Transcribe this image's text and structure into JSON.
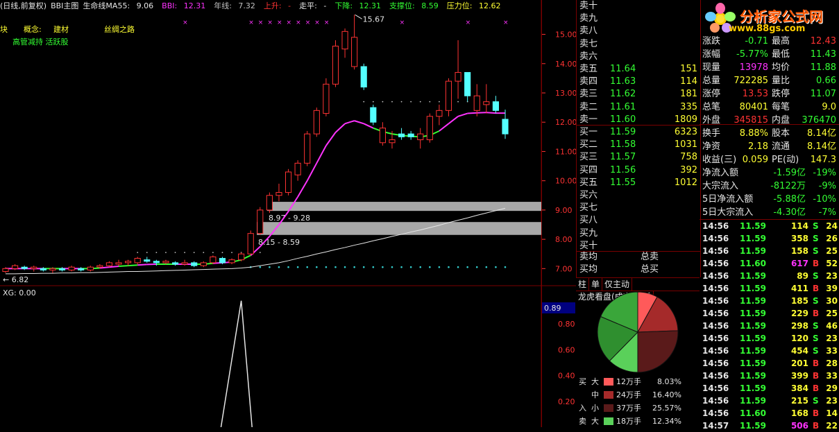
{
  "top_bar": {
    "mode": "(日线,前复权)",
    "indicator": "BBI主图",
    "ma55_label": "生命线MA55:",
    "ma55_value": "9.06",
    "bbi_label": "BBI:",
    "bbi_value": "12.31",
    "year_label": "年线:",
    "year_value": "7.32",
    "up_label": "上升:",
    "up_value": "-",
    "flat_label": "走平:",
    "flat_value": "-",
    "down_label": "下降:",
    "down_value": "12.31",
    "support_label": "支撑位:",
    "support_value": "8.59",
    "pressure_label": "压力位:",
    "pressure_value": "12.62"
  },
  "tags": {
    "t1": "块",
    "t2": "概念:",
    "t3": "建材",
    "t4": "丝绸之路",
    "t5": "高管减持 活跃股"
  },
  "annotations": {
    "high": "15.67",
    "low": "6.82",
    "zone1": "8.97 - 9.28",
    "zone2": "8.15 - 8.59",
    "xg": "XG: 0.00",
    "lower_value": "0.89"
  },
  "y_axis_main": [
    "15.00",
    "14.00",
    "13.00",
    "12.00",
    "11.00",
    "10.00",
    "9.00",
    "8.00",
    "7.00"
  ],
  "y_axis_lower": [
    "0.80",
    "0.60",
    "0.40",
    "0.20"
  ],
  "logo": {
    "title": "分析家公式网",
    "url": "www.88gs.com"
  },
  "order_book": {
    "sell": [
      {
        "label": "卖十",
        "price": "",
        "vol": ""
      },
      {
        "label": "卖九",
        "price": "",
        "vol": ""
      },
      {
        "label": "卖八",
        "price": "",
        "vol": ""
      },
      {
        "label": "卖七",
        "price": "",
        "vol": ""
      },
      {
        "label": "卖六",
        "price": "",
        "vol": ""
      },
      {
        "label": "卖五",
        "price": "11.64",
        "vol": "151"
      },
      {
        "label": "卖四",
        "price": "11.63",
        "vol": "114"
      },
      {
        "label": "卖三",
        "price": "11.62",
        "vol": "181"
      },
      {
        "label": "卖二",
        "price": "11.61",
        "vol": "335"
      },
      {
        "label": "卖一",
        "price": "11.60",
        "vol": "1809"
      }
    ],
    "buy": [
      {
        "label": "买一",
        "price": "11.59",
        "vol": "6323"
      },
      {
        "label": "买二",
        "price": "11.58",
        "vol": "1031"
      },
      {
        "label": "买三",
        "price": "11.57",
        "vol": "758"
      },
      {
        "label": "买四",
        "price": "11.56",
        "vol": "392"
      },
      {
        "label": "买五",
        "price": "11.55",
        "vol": "1012"
      },
      {
        "label": "买六",
        "price": "",
        "vol": ""
      },
      {
        "label": "买七",
        "price": "",
        "vol": ""
      },
      {
        "label": "买八",
        "price": "",
        "vol": ""
      },
      {
        "label": "买九",
        "price": "",
        "vol": ""
      },
      {
        "label": "买十",
        "price": "",
        "vol": ""
      }
    ],
    "avg_buy_label": "卖均",
    "avg_sell_label": "买均",
    "total_sell_label": "总卖",
    "total_buy_label": "总买"
  },
  "info": [
    {
      "k1": "涨跌",
      "v1": "-0.71",
      "c1": "#33ff33",
      "k2": "最高",
      "v2": "12.43",
      "c2": "#ff3333"
    },
    {
      "k1": "涨幅",
      "v1": "-5.77%",
      "c1": "#33ff33",
      "k2": "最低",
      "v2": "11.43",
      "c2": "#33ff33"
    },
    {
      "k1": "现量",
      "v1": "13978",
      "c1": "#ff33ff",
      "k2": "均价",
      "v2": "11.88",
      "c2": "#33ff33"
    },
    {
      "k1": "总量",
      "v1": "722285",
      "c1": "#ffff33",
      "k2": "量比",
      "v2": "0.66",
      "c2": "#33ff33"
    },
    {
      "k1": "涨停",
      "v1": "13.53",
      "c1": "#ff3333",
      "k2": "跌停",
      "v2": "11.07",
      "c2": "#33ff33"
    },
    {
      "k1": "总笔",
      "v1": "80401",
      "c1": "#ffff33",
      "k2": "每笔",
      "v2": "9.0",
      "c2": "#ffff33"
    },
    {
      "k1": "外盘",
      "v1": "345815",
      "c1": "#ff3333",
      "k2": "内盘",
      "v2": "376470",
      "c2": "#33ff33"
    },
    {
      "k1": "换手",
      "v1": "8.88%",
      "c1": "#ffff33",
      "k2": "股本",
      "v2": "8.14亿",
      "c2": "#ffff33"
    },
    {
      "k1": "净资",
      "v1": "2.18",
      "c1": "#ffff33",
      "k2": "流通",
      "v2": "8.14亿",
      "c2": "#ffff33"
    },
    {
      "k1": "收益(三)",
      "v1": "0.059",
      "c1": "#ffff33",
      "k2": "PE(动)",
      "v2": "147.3",
      "c2": "#ffff33"
    }
  ],
  "flow": [
    {
      "k": "净流入额",
      "v": "-1.59亿",
      "p": "-19%"
    },
    {
      "k": "大宗流入",
      "v": "-8122万",
      "p": "-9%"
    },
    {
      "k": "5日净流入额",
      "v": "-5.88亿",
      "p": "-10%"
    },
    {
      "k": "5日大宗流入",
      "v": "-4.30亿",
      "p": "-7%"
    }
  ],
  "ticks": [
    {
      "t": "14:56",
      "p": "11.59",
      "v": "114",
      "bs": "S",
      "n": "24"
    },
    {
      "t": "14:56",
      "p": "11.59",
      "v": "358",
      "bs": "S",
      "n": "26"
    },
    {
      "t": "14:56",
      "p": "11.59",
      "v": "158",
      "bs": "S",
      "n": "25"
    },
    {
      "t": "14:56",
      "p": "11.60",
      "v": "617",
      "bs": "B",
      "n": "52"
    },
    {
      "t": "14:56",
      "p": "11.59",
      "v": "89",
      "bs": "S",
      "n": "23"
    },
    {
      "t": "14:56",
      "p": "11.59",
      "v": "411",
      "bs": "B",
      "n": "39"
    },
    {
      "t": "14:56",
      "p": "11.59",
      "v": "185",
      "bs": "S",
      "n": "30"
    },
    {
      "t": "14:56",
      "p": "11.59",
      "v": "229",
      "bs": "B",
      "n": "25"
    },
    {
      "t": "14:56",
      "p": "11.59",
      "v": "298",
      "bs": "S",
      "n": "46"
    },
    {
      "t": "14:56",
      "p": "11.59",
      "v": "120",
      "bs": "S",
      "n": "23"
    },
    {
      "t": "14:56",
      "p": "11.59",
      "v": "454",
      "bs": "S",
      "n": "33"
    },
    {
      "t": "14:56",
      "p": "11.59",
      "v": "201",
      "bs": "B",
      "n": "28"
    },
    {
      "t": "14:56",
      "p": "11.59",
      "v": "399",
      "bs": "B",
      "n": "33"
    },
    {
      "t": "14:56",
      "p": "11.59",
      "v": "384",
      "bs": "B",
      "n": "29"
    },
    {
      "t": "14:56",
      "p": "11.59",
      "v": "215",
      "bs": "S",
      "n": "23"
    },
    {
      "t": "14:56",
      "p": "11.60",
      "v": "168",
      "bs": "B",
      "n": "14"
    },
    {
      "t": "14:57",
      "p": "11.59",
      "v": "506",
      "bs": "B",
      "n": "22"
    }
  ],
  "tabs": [
    "柱",
    "单",
    "仅主动",
    "龙虎看盘(成交量/拆"
  ],
  "pie_legend": [
    {
      "side": "买",
      "sz": "大",
      "amt": "12万手",
      "pct": "8.03%",
      "color": "#ff5a5a"
    },
    {
      "side": "",
      "sz": "中",
      "amt": "24万手",
      "pct": "16.40%",
      "color": "#a52a2a"
    },
    {
      "side": "入",
      "sz": "小",
      "amt": "37万手",
      "pct": "25.57%",
      "color": "#5a1a1a"
    },
    {
      "side": "卖",
      "sz": "大",
      "amt": "18万手",
      "pct": "12.34%",
      "color": "#5ad05a"
    }
  ],
  "chart_data": {
    "type": "candlestick",
    "ylim": [
      6.7,
      15.7
    ],
    "candles": [
      [
        6.9,
        7.0,
        6.85,
        7.05,
        "up"
      ],
      [
        7.0,
        7.1,
        6.95,
        7.15,
        "up"
      ],
      [
        7.05,
        7.0,
        6.95,
        7.1,
        "down"
      ],
      [
        7.0,
        7.05,
        6.9,
        7.1,
        "up"
      ],
      [
        7.0,
        6.95,
        6.9,
        7.05,
        "down"
      ],
      [
        6.95,
        7.0,
        6.85,
        7.05,
        "up"
      ],
      [
        7.0,
        6.95,
        6.9,
        7.05,
        "down"
      ],
      [
        6.95,
        7.05,
        6.9,
        7.1,
        "up"
      ],
      [
        7.0,
        6.95,
        6.9,
        7.05,
        "down"
      ],
      [
        6.95,
        7.05,
        6.9,
        7.1,
        "up"
      ],
      [
        7.05,
        7.1,
        7.0,
        7.15,
        "up"
      ],
      [
        7.1,
        7.2,
        7.05,
        7.25,
        "up"
      ],
      [
        7.15,
        7.2,
        7.1,
        7.3,
        "up"
      ],
      [
        7.2,
        7.25,
        7.1,
        7.3,
        "up"
      ],
      [
        7.2,
        7.35,
        7.15,
        7.4,
        "up"
      ],
      [
        7.3,
        7.25,
        7.2,
        7.4,
        "down"
      ],
      [
        7.25,
        7.2,
        7.1,
        7.3,
        "down"
      ],
      [
        7.2,
        7.25,
        7.15,
        7.3,
        "up"
      ],
      [
        7.2,
        7.15,
        7.1,
        7.25,
        "down"
      ],
      [
        7.15,
        7.2,
        7.1,
        7.3,
        "up"
      ],
      [
        7.2,
        7.1,
        7.05,
        7.25,
        "down"
      ],
      [
        7.1,
        7.2,
        7.05,
        7.25,
        "up"
      ],
      [
        7.2,
        7.4,
        7.15,
        7.45,
        "up"
      ],
      [
        7.35,
        7.2,
        7.15,
        7.4,
        "down"
      ],
      [
        7.2,
        7.3,
        7.15,
        7.35,
        "up"
      ],
      [
        7.3,
        7.5,
        7.25,
        7.55,
        "up"
      ],
      [
        7.5,
        8.2,
        7.45,
        8.3,
        "up"
      ],
      [
        8.2,
        9.0,
        8.15,
        9.1,
        "up"
      ],
      [
        9.0,
        9.5,
        8.9,
        9.6,
        "up"
      ],
      [
        9.5,
        9.6,
        9.3,
        9.9,
        "up"
      ],
      [
        9.6,
        10.3,
        9.5,
        10.4,
        "up"
      ],
      [
        10.2,
        10.6,
        10.0,
        10.7,
        "up"
      ],
      [
        10.6,
        11.6,
        10.5,
        11.7,
        "up"
      ],
      [
        11.6,
        12.4,
        11.5,
        12.5,
        "up"
      ],
      [
        12.3,
        13.3,
        12.2,
        13.5,
        "up"
      ],
      [
        13.3,
        14.6,
        13.2,
        14.8,
        "up"
      ],
      [
        14.5,
        15.1,
        14.2,
        15.2,
        "up"
      ],
      [
        14.9,
        13.9,
        13.8,
        15.67,
        "up"
      ],
      [
        13.9,
        13.2,
        13.1,
        14.0,
        "down"
      ],
      [
        12.5,
        12.0,
        11.9,
        12.6,
        "down"
      ],
      [
        11.8,
        11.3,
        11.2,
        12.0,
        "up"
      ],
      [
        11.4,
        11.3,
        11.1,
        11.7,
        "up"
      ],
      [
        11.5,
        11.6,
        11.4,
        11.8,
        "down"
      ],
      [
        11.6,
        11.5,
        11.4,
        11.7,
        "down"
      ],
      [
        11.6,
        11.4,
        11.1,
        11.8,
        "up"
      ],
      [
        11.4,
        12.2,
        11.3,
        12.3,
        "up"
      ],
      [
        12.2,
        12.4,
        11.9,
        12.6,
        "up"
      ],
      [
        12.4,
        13.4,
        12.2,
        13.5,
        "up"
      ],
      [
        13.4,
        13.7,
        12.8,
        14.8,
        "up"
      ],
      [
        13.7,
        12.9,
        12.7,
        13.4,
        "down"
      ],
      [
        12.9,
        12.4,
        12.2,
        13.3,
        "up"
      ],
      [
        12.7,
        12.6,
        12.3,
        13.3,
        "up"
      ],
      [
        12.7,
        12.4,
        12.3,
        12.9,
        "down"
      ],
      [
        12.1,
        11.6,
        11.43,
        12.43,
        "down"
      ]
    ],
    "series": [
      {
        "name": "BBI",
        "values": [
          7.0,
          7.0,
          7.0,
          7.0,
          7.0,
          7.0,
          7.0,
          7.0,
          7.0,
          7.0,
          7.02,
          7.05,
          7.08,
          7.1,
          7.12,
          7.14,
          7.15,
          7.15,
          7.15,
          7.15,
          7.15,
          7.15,
          7.18,
          7.2,
          7.22,
          7.3,
          7.45,
          7.75,
          8.1,
          8.5,
          8.95,
          9.45,
          10.0,
          10.6,
          11.2,
          11.65,
          11.95,
          12.05,
          11.95,
          11.8,
          11.68,
          11.6,
          11.55,
          11.52,
          11.5,
          11.55,
          11.7,
          11.95,
          12.2,
          12.3,
          12.32,
          12.33,
          12.31,
          12.31
        ]
      },
      {
        "name": "年线",
        "values": [
          6.82,
          6.82,
          6.83,
          6.83,
          6.84,
          6.84,
          6.85,
          6.85,
          6.86,
          6.86,
          6.87,
          6.88,
          6.89,
          6.9,
          6.9,
          6.91,
          6.92,
          6.93,
          6.94,
          6.95,
          6.96,
          6.97,
          6.98,
          6.99,
          7.0,
          7.02,
          7.05,
          7.1,
          7.15,
          7.2,
          7.27,
          7.35,
          7.42,
          7.5,
          7.57,
          7.65,
          7.72,
          7.8,
          7.87,
          7.95,
          8.02,
          8.1,
          8.17,
          8.25,
          8.32,
          8.4,
          8.48,
          8.57,
          8.65,
          8.73,
          8.82,
          8.9,
          8.98,
          9.06
        ]
      }
    ],
    "lower": {
      "xg": 0.0,
      "spike_value": 1.0
    }
  }
}
